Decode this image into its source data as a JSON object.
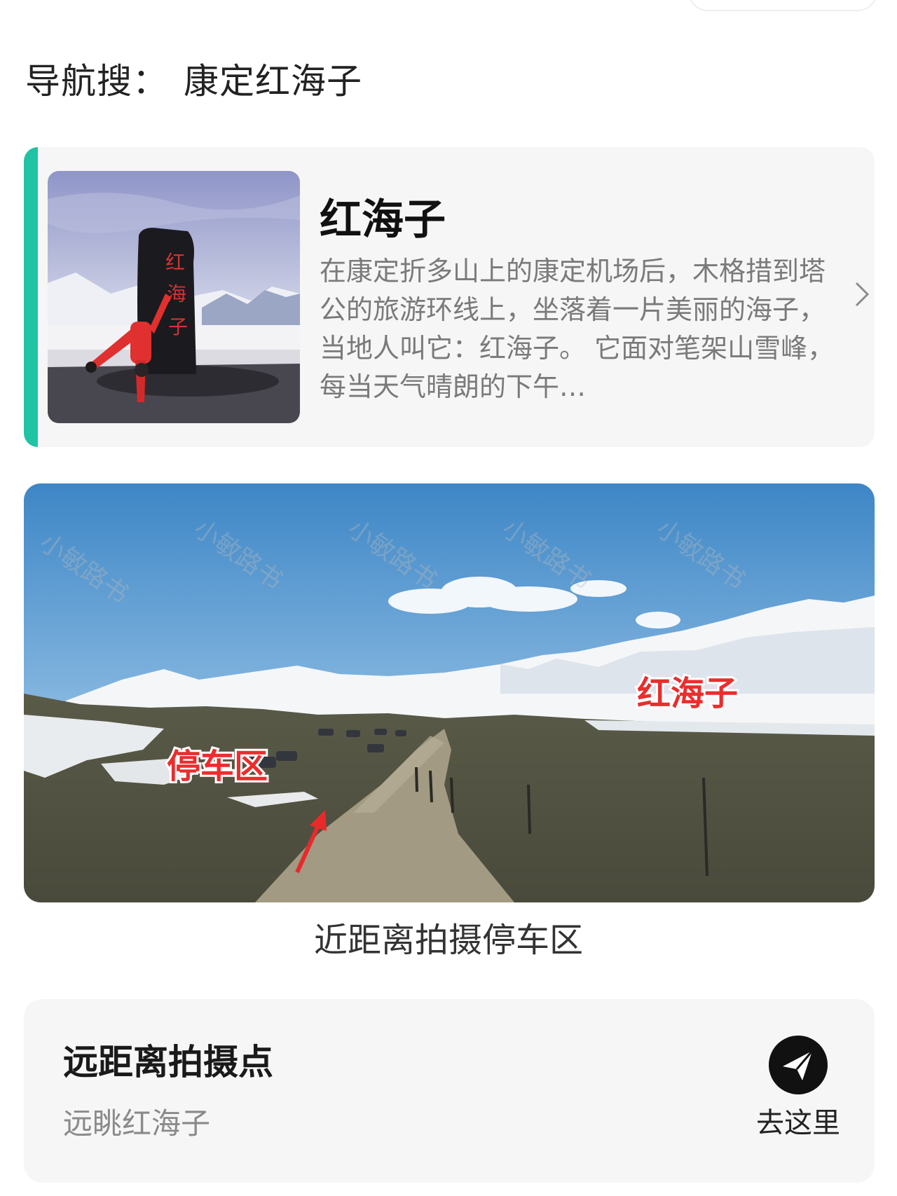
{
  "navigation": {
    "prefix": "导航搜",
    "colon": "：",
    "keyword": "康定红海子"
  },
  "poi_card": {
    "title": "红海子",
    "description": "在康定折多山上的康定机场后，木格措到塔公的旅游环线上，坐落着一片美丽的海子，当地人叫它：红海子。 它面对笔架山雪峰，每当天气晴朗的下午…",
    "thumbnail_stone_text": [
      "红",
      "海",
      "子"
    ],
    "accent_color": "#20c3a4",
    "chevron_icon": "chevron-right-icon"
  },
  "scene_photo": {
    "label_lake": "红海子",
    "label_parking": "停车区",
    "watermark": "小敏路书",
    "caption": "近距离拍摄停车区"
  },
  "spot_card": {
    "title": "远距离拍摄点",
    "subtitle": "远眺红海子",
    "go_label": "去这里",
    "go_icon": "navigate-arrow-icon"
  }
}
